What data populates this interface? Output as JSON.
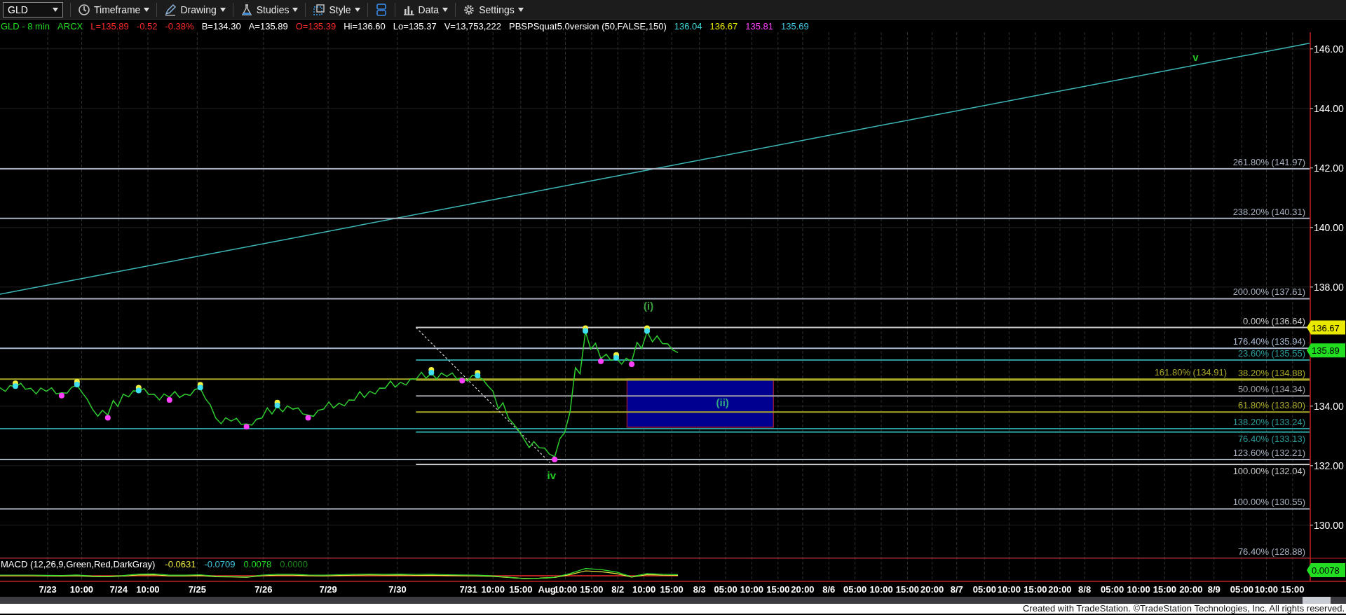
{
  "toolbar": {
    "symbol": "GLD",
    "buttons": [
      {
        "kind": "menu",
        "label": "Timeframe"
      },
      {
        "kind": "menu",
        "label": "Drawing"
      },
      {
        "kind": "menu",
        "label": "Studies"
      },
      {
        "kind": "menu",
        "label": "Style"
      },
      {
        "kind": "icon"
      },
      {
        "kind": "menu",
        "label": "Data"
      },
      {
        "kind": "menu",
        "label": "Settings"
      }
    ]
  },
  "info_line": [
    {
      "text": "GLD - 8 min",
      "color": "#22dd22"
    },
    {
      "text": "ARCX",
      "color": "#22dd22"
    },
    {
      "text": "L=135.89",
      "color": "#ff2a2a"
    },
    {
      "text": "-0.52",
      "color": "#ff2a2a"
    },
    {
      "text": "-0.38%",
      "color": "#ff2a2a"
    },
    {
      "text": "B=134.30",
      "color": "#ffffff"
    },
    {
      "text": "A=135.89",
      "color": "#ffffff"
    },
    {
      "text": "O=135.39",
      "color": "#ff2a2a"
    },
    {
      "text": "Hi=136.60",
      "color": "#ffffff"
    },
    {
      "text": "Lo=135.37",
      "color": "#ffffff"
    },
    {
      "text": "V=13,753,222",
      "color": "#ffffff"
    },
    {
      "text": "PBSPSquat5.0version (50,FALSE,150)",
      "color": "#ffffff"
    },
    {
      "text": "136.04",
      "color": "#40d8d8"
    },
    {
      "text": "136.67",
      "color": "#e8e800"
    },
    {
      "text": "135.81",
      "color": "#ff40ff"
    },
    {
      "text": "135.69",
      "color": "#40c8e0"
    }
  ],
  "chart": {
    "price_axis": [
      "146.00",
      "144.00",
      "142.00",
      "140.00",
      "138.00",
      "134.00",
      "132.00",
      "130.00"
    ],
    "fib_levels": [
      {
        "label": "261.80% (141.97)",
        "color": "#a8b0c0"
      },
      {
        "label": "238.20% (140.31)",
        "color": "#a8b0c0"
      },
      {
        "label": "200.00% (137.61)",
        "color": "#a8b0c0"
      },
      {
        "label": "0.00% (136.64)",
        "color": "#c8c8c8"
      },
      {
        "label": "176.40% (135.94)",
        "color": "#a8b8d0"
      },
      {
        "label": "23.60% (135.55)",
        "color": "#2a9a9a"
      },
      {
        "label": "161.80% (134.91)",
        "color": "#a8a828"
      },
      {
        "label": "38.20% (134.88)",
        "color": "#a8a828"
      },
      {
        "label": "50.00% (134.34)",
        "color": "#a0a0a8"
      },
      {
        "label": "61.80% (133.80)",
        "color": "#a8a828"
      },
      {
        "label": "138.20% (133.24)",
        "color": "#2a9a9a"
      },
      {
        "label": "76.40% (133.13)",
        "color": "#2a9a9a"
      },
      {
        "label": "123.60% (132.21)",
        "color": "#a8b0c0"
      },
      {
        "label": "100.00% (132.04)",
        "color": "#c8c8c8"
      },
      {
        "label": "100.00% (130.55)",
        "color": "#a8b0c0"
      },
      {
        "label": "76.40% (128.88)",
        "color": "#a8b0c0"
      }
    ],
    "wave_labels": [
      {
        "text": "v",
        "color": "#22cc22"
      },
      {
        "text": "(i)",
        "color": "#3ca03c"
      },
      {
        "text": "iv",
        "color": "#22cc22"
      },
      {
        "text": "(ii)",
        "color": "#30a880"
      }
    ],
    "price_tags": [
      {
        "text": "136.67",
        "color": "#e8e800"
      },
      {
        "text": "135.89",
        "color": "#22dd22"
      }
    ],
    "macd": {
      "label": "MACD (12,26,9,Green,Red,DarkGray)",
      "values": [
        {
          "text": "-0.0631",
          "color": "#e8e840"
        },
        {
          "text": "-0.0709",
          "color": "#40c8e0"
        },
        {
          "text": "0.0078",
          "color": "#22dd22"
        },
        {
          "text": "0.0000",
          "color": "#1a8a1a"
        }
      ],
      "tag": {
        "text": "0.0078",
        "color": "#22dd22"
      }
    },
    "time_axis": [
      "7/23",
      "10:00",
      "7/24",
      "10:00",
      "7/25",
      "7/26",
      "7/29",
      "7/30",
      "7/31",
      "10:00",
      "15:00",
      "Aug",
      "10:00",
      "15:00",
      "8/2",
      "10:00",
      "15:00",
      "8/3",
      "05:00",
      "10:00",
      "15:00",
      "20:00",
      "8/6",
      "05:00",
      "10:00",
      "15:00",
      "20:00",
      "8/7",
      "05:00",
      "10:00",
      "15:00",
      "20:00",
      "8/8",
      "05:00",
      "10:00",
      "15:00",
      "20:00",
      "8/9",
      "05:00",
      "10:00",
      "15:00"
    ]
  },
  "footer": "Created with TradeStation. ©TradeStation Technologies, Inc. All rights reserved."
}
